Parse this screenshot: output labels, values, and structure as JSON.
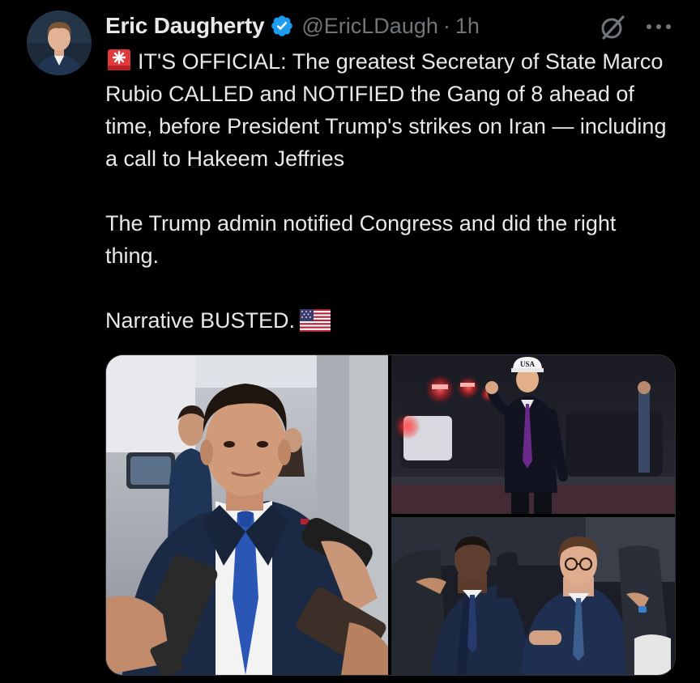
{
  "author": {
    "name": "Eric Daugherty",
    "handle": "@EricLDaugh",
    "separator": "·",
    "time": "1h"
  },
  "body": {
    "paragraph_1": "IT'S OFFICIAL: The greatest Secretary of State Marco Rubio CALLED and NOTIFIED the Gang of 8 ahead of time, before President Trump's strikes on Iran — including a call to Hakeem Jeffries",
    "paragraph_2": "The Trump admin notified Congress and did the right thing.",
    "paragraph_3": "Narrative BUSTED."
  },
  "icons": {
    "verified": "verified-badge-icon",
    "grok": "grok-icon",
    "more": "more-options-icon",
    "siren": "rotating-light-emoji",
    "flag": "us-flag-emoji"
  },
  "colors": {
    "background": "#000000",
    "text": "#e7e9ea",
    "muted": "#71767b",
    "verified": "#1d9bf0"
  },
  "media": {
    "count": 3,
    "trump_cap_text": "USA"
  }
}
